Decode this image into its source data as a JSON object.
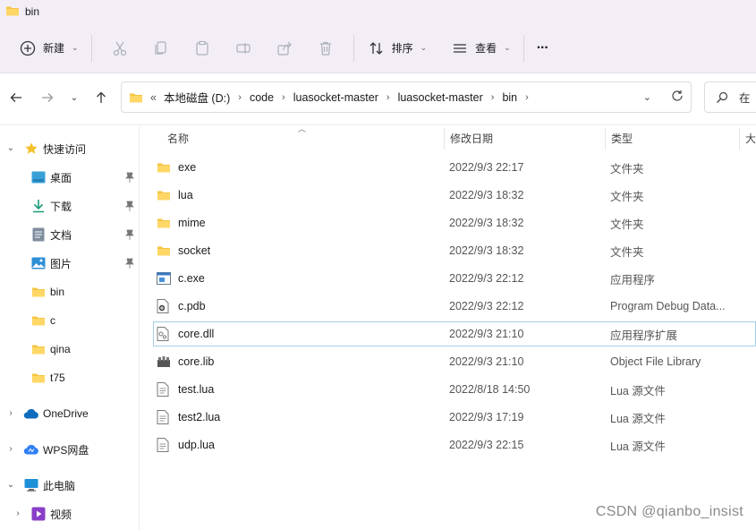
{
  "window": {
    "title": "bin"
  },
  "toolbar": {
    "new_label": "新建",
    "sort_label": "排序",
    "view_label": "查看",
    "more_label": "···"
  },
  "address": {
    "overflow": "«",
    "crumbs": [
      "本地磁盘 (D:)",
      "code",
      "luasocket-master",
      "luasocket-master",
      "bin"
    ]
  },
  "search": {
    "placeholder": "在"
  },
  "sidebar": {
    "quick_access": "快速访问",
    "items": [
      {
        "label": "桌面",
        "icon": "desktop-icon",
        "pinned": true
      },
      {
        "label": "下载",
        "icon": "download-icon",
        "pinned": true
      },
      {
        "label": "文档",
        "icon": "document-icon",
        "pinned": true
      },
      {
        "label": "图片",
        "icon": "picture-icon",
        "pinned": true
      },
      {
        "label": "bin",
        "icon": "folder-icon",
        "pinned": false
      },
      {
        "label": "c",
        "icon": "folder-icon",
        "pinned": false
      },
      {
        "label": "qina",
        "icon": "folder-icon",
        "pinned": false
      },
      {
        "label": "t75",
        "icon": "folder-icon",
        "pinned": false
      }
    ],
    "onedrive": "OneDrive",
    "wps": "WPS网盘",
    "this_pc": "此电脑",
    "video": "视频"
  },
  "columns": {
    "name": "名称",
    "date": "修改日期",
    "type": "类型",
    "size": "大"
  },
  "files": [
    {
      "name": "exe",
      "date": "2022/9/3 22:17",
      "type": "文件夹",
      "icon": "folder-icon"
    },
    {
      "name": "lua",
      "date": "2022/9/3 18:32",
      "type": "文件夹",
      "icon": "folder-icon"
    },
    {
      "name": "mime",
      "date": "2022/9/3 18:32",
      "type": "文件夹",
      "icon": "folder-icon"
    },
    {
      "name": "socket",
      "date": "2022/9/3 18:32",
      "type": "文件夹",
      "icon": "folder-icon"
    },
    {
      "name": "c.exe",
      "date": "2022/9/3 22:12",
      "type": "应用程序",
      "icon": "exe-icon"
    },
    {
      "name": "c.pdb",
      "date": "2022/9/3 22:12",
      "type": "Program Debug Data...",
      "icon": "pdb-icon"
    },
    {
      "name": "core.dll",
      "date": "2022/9/3 21:10",
      "type": "应用程序扩展",
      "icon": "dll-icon"
    },
    {
      "name": "core.lib",
      "date": "2022/9/3 21:10",
      "type": "Object File Library",
      "icon": "lib-icon"
    },
    {
      "name": "test.lua",
      "date": "2022/8/18 14:50",
      "type": "Lua 源文件",
      "icon": "text-file-icon"
    },
    {
      "name": "test2.lua",
      "date": "2022/9/3 17:19",
      "type": "Lua 源文件",
      "icon": "text-file-icon"
    },
    {
      "name": "udp.lua",
      "date": "2022/9/3 22:15",
      "type": "Lua 源文件",
      "icon": "text-file-icon"
    }
  ],
  "watermark": "CSDN @qianbo_insist"
}
